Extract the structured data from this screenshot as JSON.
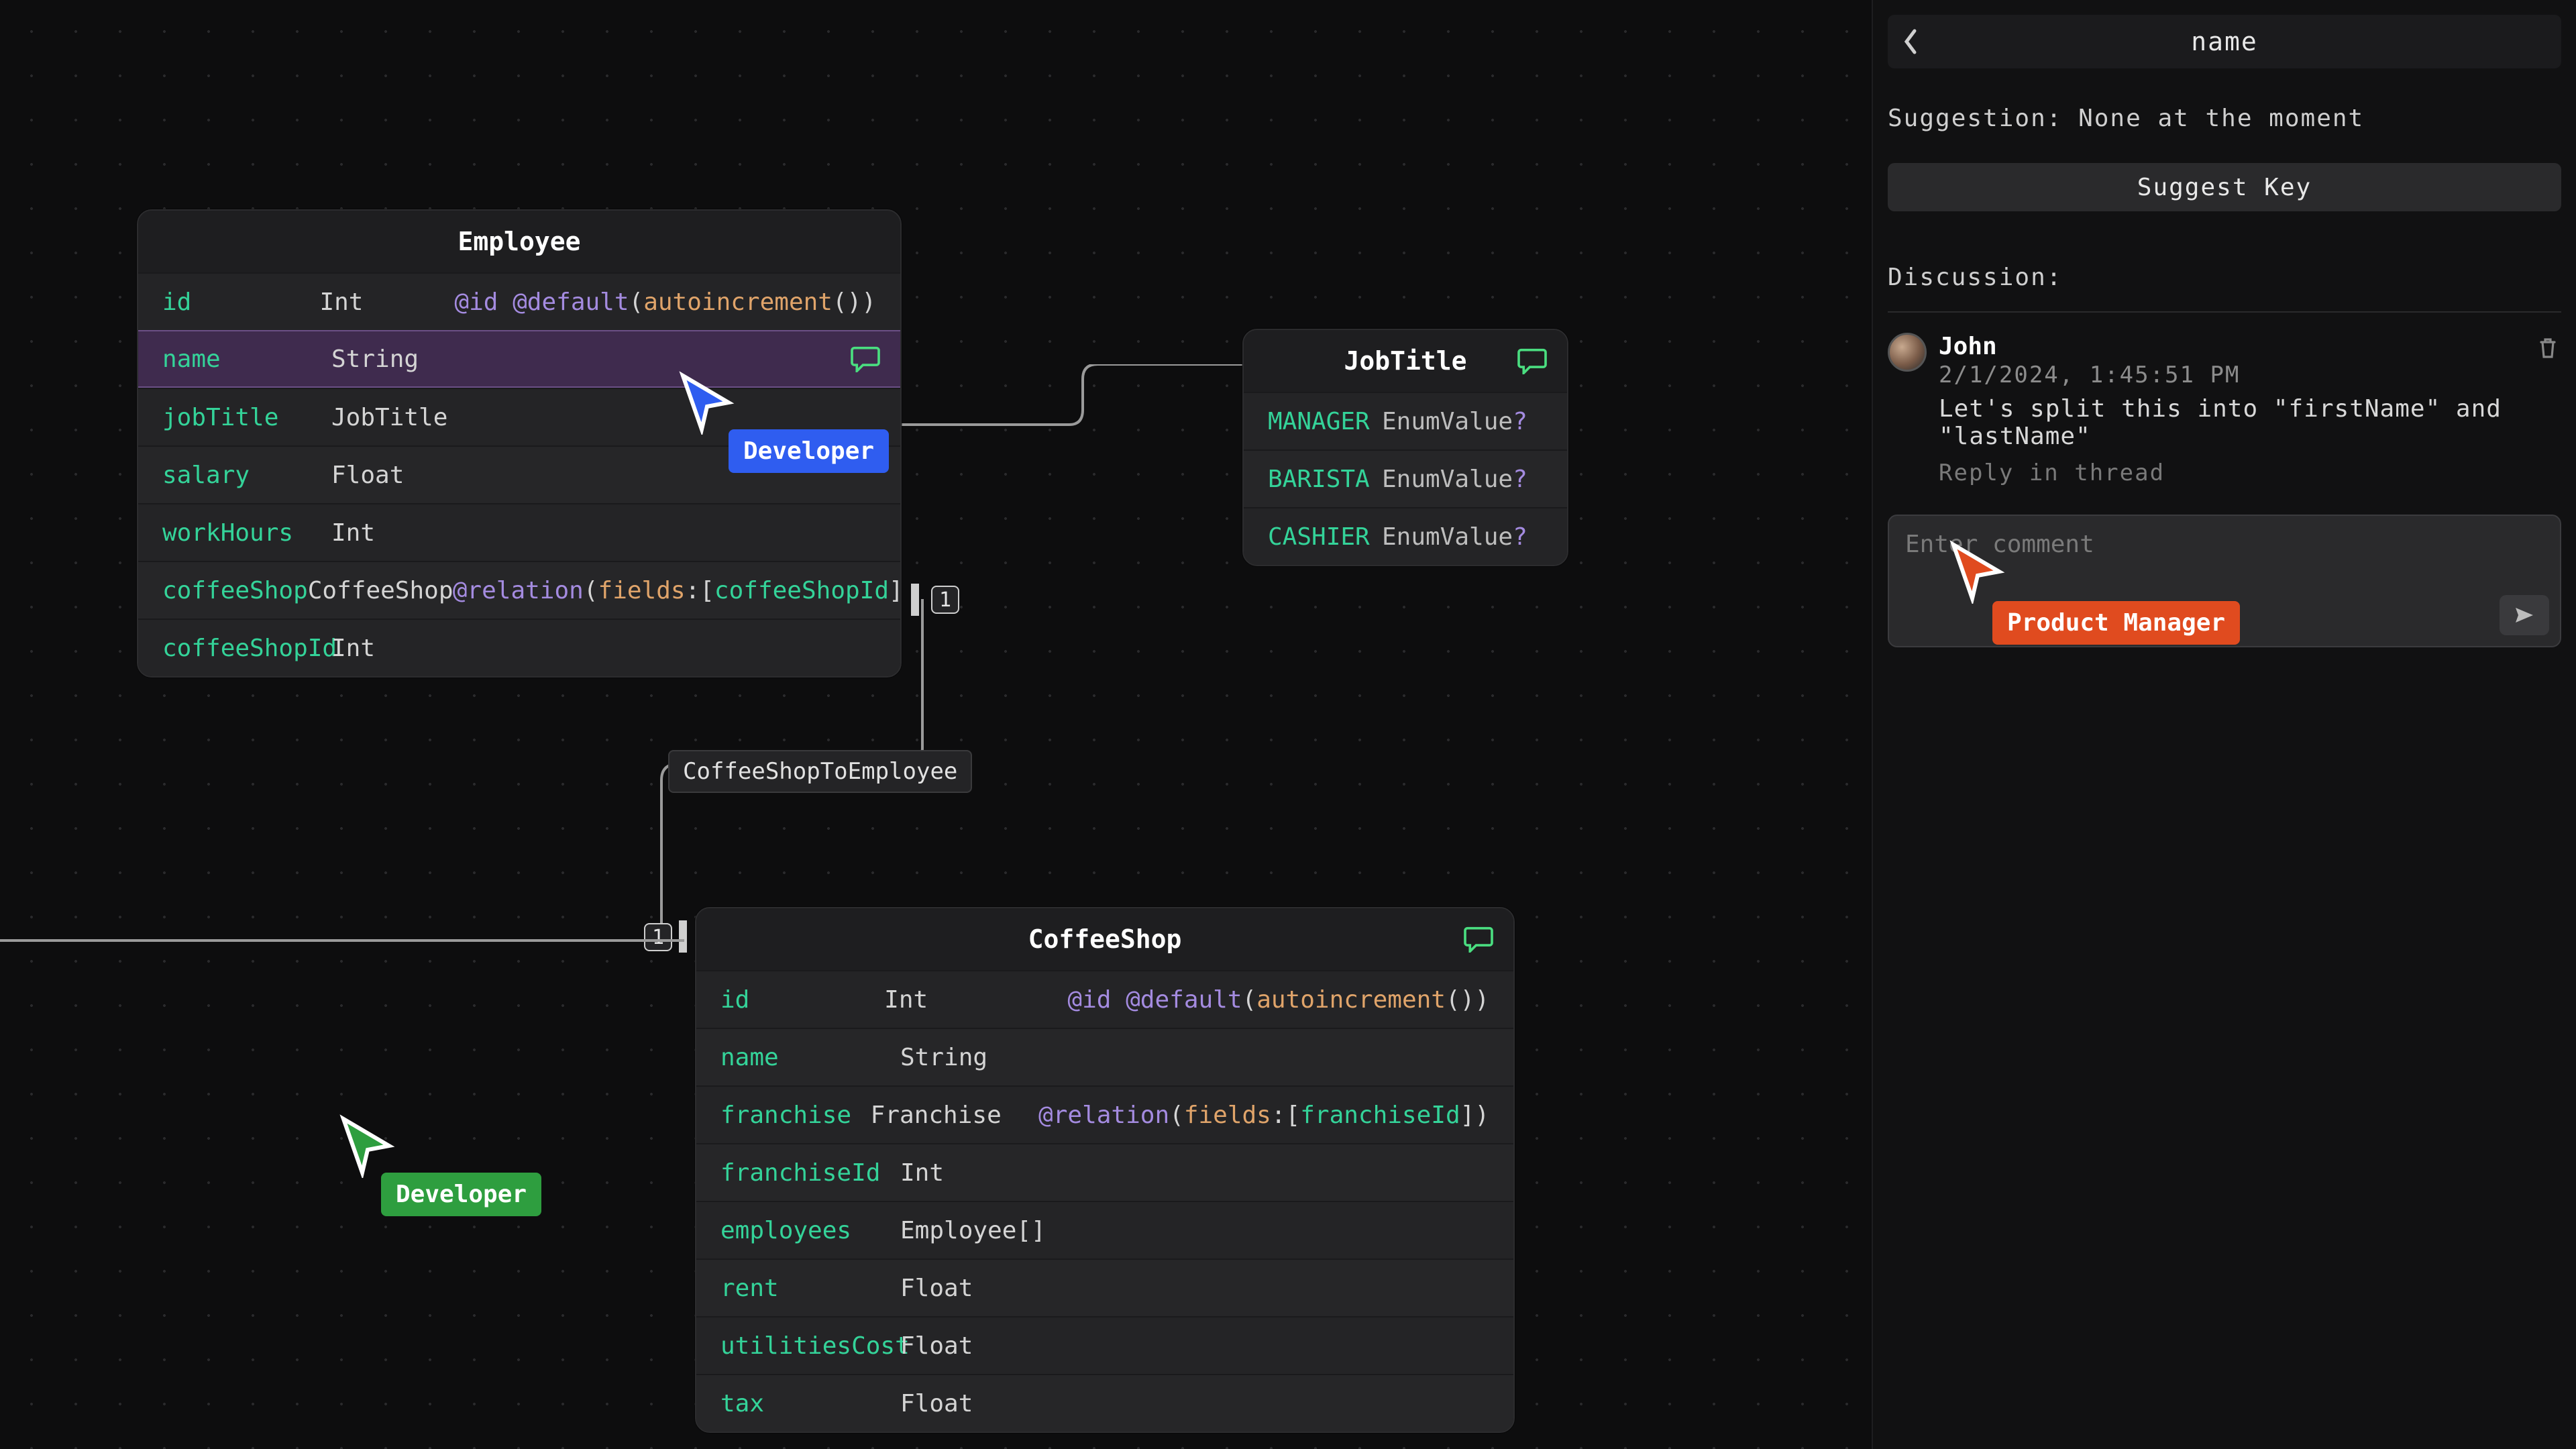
{
  "panel": {
    "title": "name",
    "suggestion_line": "Suggestion: None at the moment",
    "suggest_btn": "Suggest Key",
    "discussion_label": "Discussion:",
    "comment_placeholder": "Enter comment"
  },
  "comments": [
    {
      "author": "John",
      "time": "2/1/2024, 1:45:51 PM",
      "body": "Let's split this into \"firstName\" and \"lastName\"",
      "reply": "Reply in thread"
    }
  ],
  "entities": {
    "employee": {
      "title": "Employee",
      "rows": [
        {
          "name": "id",
          "type": "Int",
          "attr": {
            "kw": "@id @default",
            "paren_open": "(",
            "fn": "autoincrement",
            "paren_close": "())"
          }
        },
        {
          "name": "name",
          "type": "String",
          "selected": true,
          "has_chat": true
        },
        {
          "name": "jobTitle",
          "type": "JobTitle"
        },
        {
          "name": "salary",
          "type": "Float"
        },
        {
          "name": "workHours",
          "type": "Int"
        },
        {
          "name": "coffeeShop",
          "type": "CoffeeShop",
          "attr": {
            "rel": "@relation",
            "open": "(",
            "k": "fields",
            "colon": ":[",
            "fid": "coffeeShopId",
            "close": "])"
          }
        },
        {
          "name": "coffeeShopId",
          "type": "Int"
        }
      ]
    },
    "jobtitle": {
      "title": "JobTitle",
      "rows": [
        {
          "name": "MANAGER",
          "type": "EnumValue",
          "opt": "?"
        },
        {
          "name": "BARISTA",
          "type": "EnumValue",
          "opt": "?"
        },
        {
          "name": "CASHIER",
          "type": "EnumValue",
          "opt": "?"
        }
      ]
    },
    "coffeeshop": {
      "title": "CoffeeShop",
      "rows": [
        {
          "name": "id",
          "type": "Int",
          "attr": {
            "kw": "@id @default",
            "paren_open": "(",
            "fn": "autoincrement",
            "paren_close": "())"
          }
        },
        {
          "name": "name",
          "type": "String"
        },
        {
          "name": "franchise",
          "type": "Franchise",
          "attr": {
            "rel": "@relation",
            "open": "(",
            "k": "fields",
            "colon": ":[",
            "fid": "franchiseId",
            "close": "])"
          }
        },
        {
          "name": "franchiseId",
          "type": "Int"
        },
        {
          "name": "employees",
          "type": "Employee",
          "arr": "[]"
        },
        {
          "name": "rent",
          "type": "Float"
        },
        {
          "name": "utilitiesCost",
          "type": "Float"
        },
        {
          "name": "tax",
          "type": "Float"
        }
      ]
    }
  },
  "relations": {
    "coffeeShopToEmployee_label": "CoffeeShopToEmployee",
    "one": "1"
  },
  "cursors": {
    "blue": {
      "label": "Developer",
      "color": "#2f5df0"
    },
    "green": {
      "label": "Developer",
      "color": "#2e9e3f"
    },
    "orange": {
      "label": "Product Manager",
      "color": "#e04b1f"
    }
  }
}
